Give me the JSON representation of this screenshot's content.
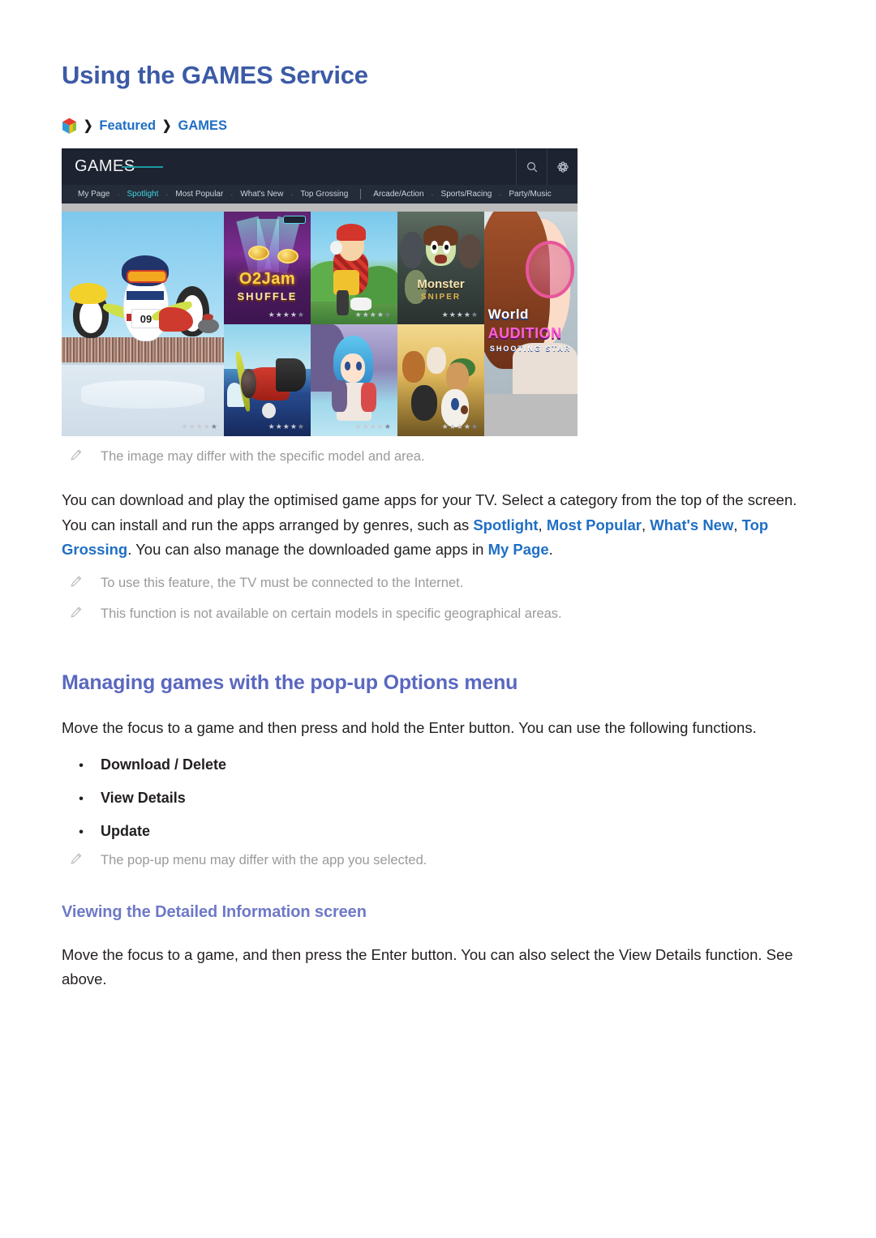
{
  "page": {
    "title": "Using the GAMES Service"
  },
  "breadcrumb": {
    "icon": "samsung-cube-icon",
    "separator": "❯",
    "items": [
      "Featured",
      "GAMES"
    ]
  },
  "screenshot": {
    "logo": "GAMES",
    "actions": [
      {
        "name": "search-icon",
        "label": "Search"
      },
      {
        "name": "settings-gear-icon",
        "label": "Settings"
      }
    ],
    "nav": {
      "separator": "·",
      "groups": [
        [
          "My Page",
          "Spotlight",
          "Most Popular",
          "What's New",
          "Top Grossing"
        ],
        [
          "Arcade/Action",
          "Sports/Racing",
          "Party/Music"
        ]
      ],
      "active": "Spotlight"
    },
    "tiles": [
      {
        "name": "penguin-curling-game",
        "rating": 4,
        "max_rating": 5,
        "badge": "09",
        "show_stars": true
      },
      {
        "name": "ojam-shuffle-game",
        "title": "O2Jam",
        "subtitle": "SHUFFLE",
        "rating": 4,
        "max_rating": 5,
        "show_stars": true
      },
      {
        "name": "biplane-game",
        "rating": 4,
        "max_rating": 5,
        "show_stars": true
      },
      {
        "name": "red-cape-hero-game",
        "rating": 4,
        "max_rating": 5,
        "show_stars": true
      },
      {
        "name": "monster-sniper-game",
        "title": "Monster",
        "subtitle": "SNIPER",
        "rating": 4,
        "max_rating": 5,
        "show_stars": true
      },
      {
        "name": "anime-girl-game",
        "rating": 4,
        "max_rating": 5,
        "show_stars": true
      },
      {
        "name": "puppy-game",
        "rating": 4,
        "max_rating": 5,
        "show_stars": true
      },
      {
        "name": "world-audition-game",
        "title": "World",
        "subtitle": "AUDITION",
        "tagline": "SHOOTING STAR",
        "show_stars": false
      }
    ],
    "star_filled": "★",
    "star_empty": "★"
  },
  "notes": {
    "image_disclaimer": "The image may differ with the specific model and area.",
    "internet_required": "To use this feature, the TV must be connected to the Internet.",
    "region_limited": "This function is not available on certain models in specific geographical areas.",
    "popup_varies": "The pop-up menu may differ with the app you selected."
  },
  "intro": {
    "part1": "You can download and play the optimised game apps for your TV. Select a category from the top of the screen. You can install and run the apps arranged by genres, such as ",
    "kw1": "Spotlight",
    "sep1": ", ",
    "kw2": "Most Popular",
    "sep2": ", ",
    "kw3": "What's New",
    "sep3": ", ",
    "kw4": "Top Grossing",
    "part2": ". You can also manage the downloaded game apps in ",
    "kw5": "My Page",
    "part3": "."
  },
  "managing_section": {
    "heading": "Managing games with the pop-up Options menu",
    "body": "Move the focus to a game and then press and hold the Enter button. You can use the following functions.",
    "bullet_marker": "•",
    "bullets": [
      "Download / Delete",
      "View Details",
      "Update"
    ]
  },
  "viewing_section": {
    "heading": "Viewing the Detailed Information screen",
    "body": "Move the focus to a game, and then press the Enter button. You can also select the View Details function. See above."
  },
  "colors": {
    "h1": "#3c5aa6",
    "h2": "#5a68c0",
    "h3": "#6e79c8",
    "link": "#1f6fc4",
    "note_text": "#9a9a9a",
    "nav_active": "#3fd6e0",
    "shot_header_bg": "#1d2330"
  }
}
